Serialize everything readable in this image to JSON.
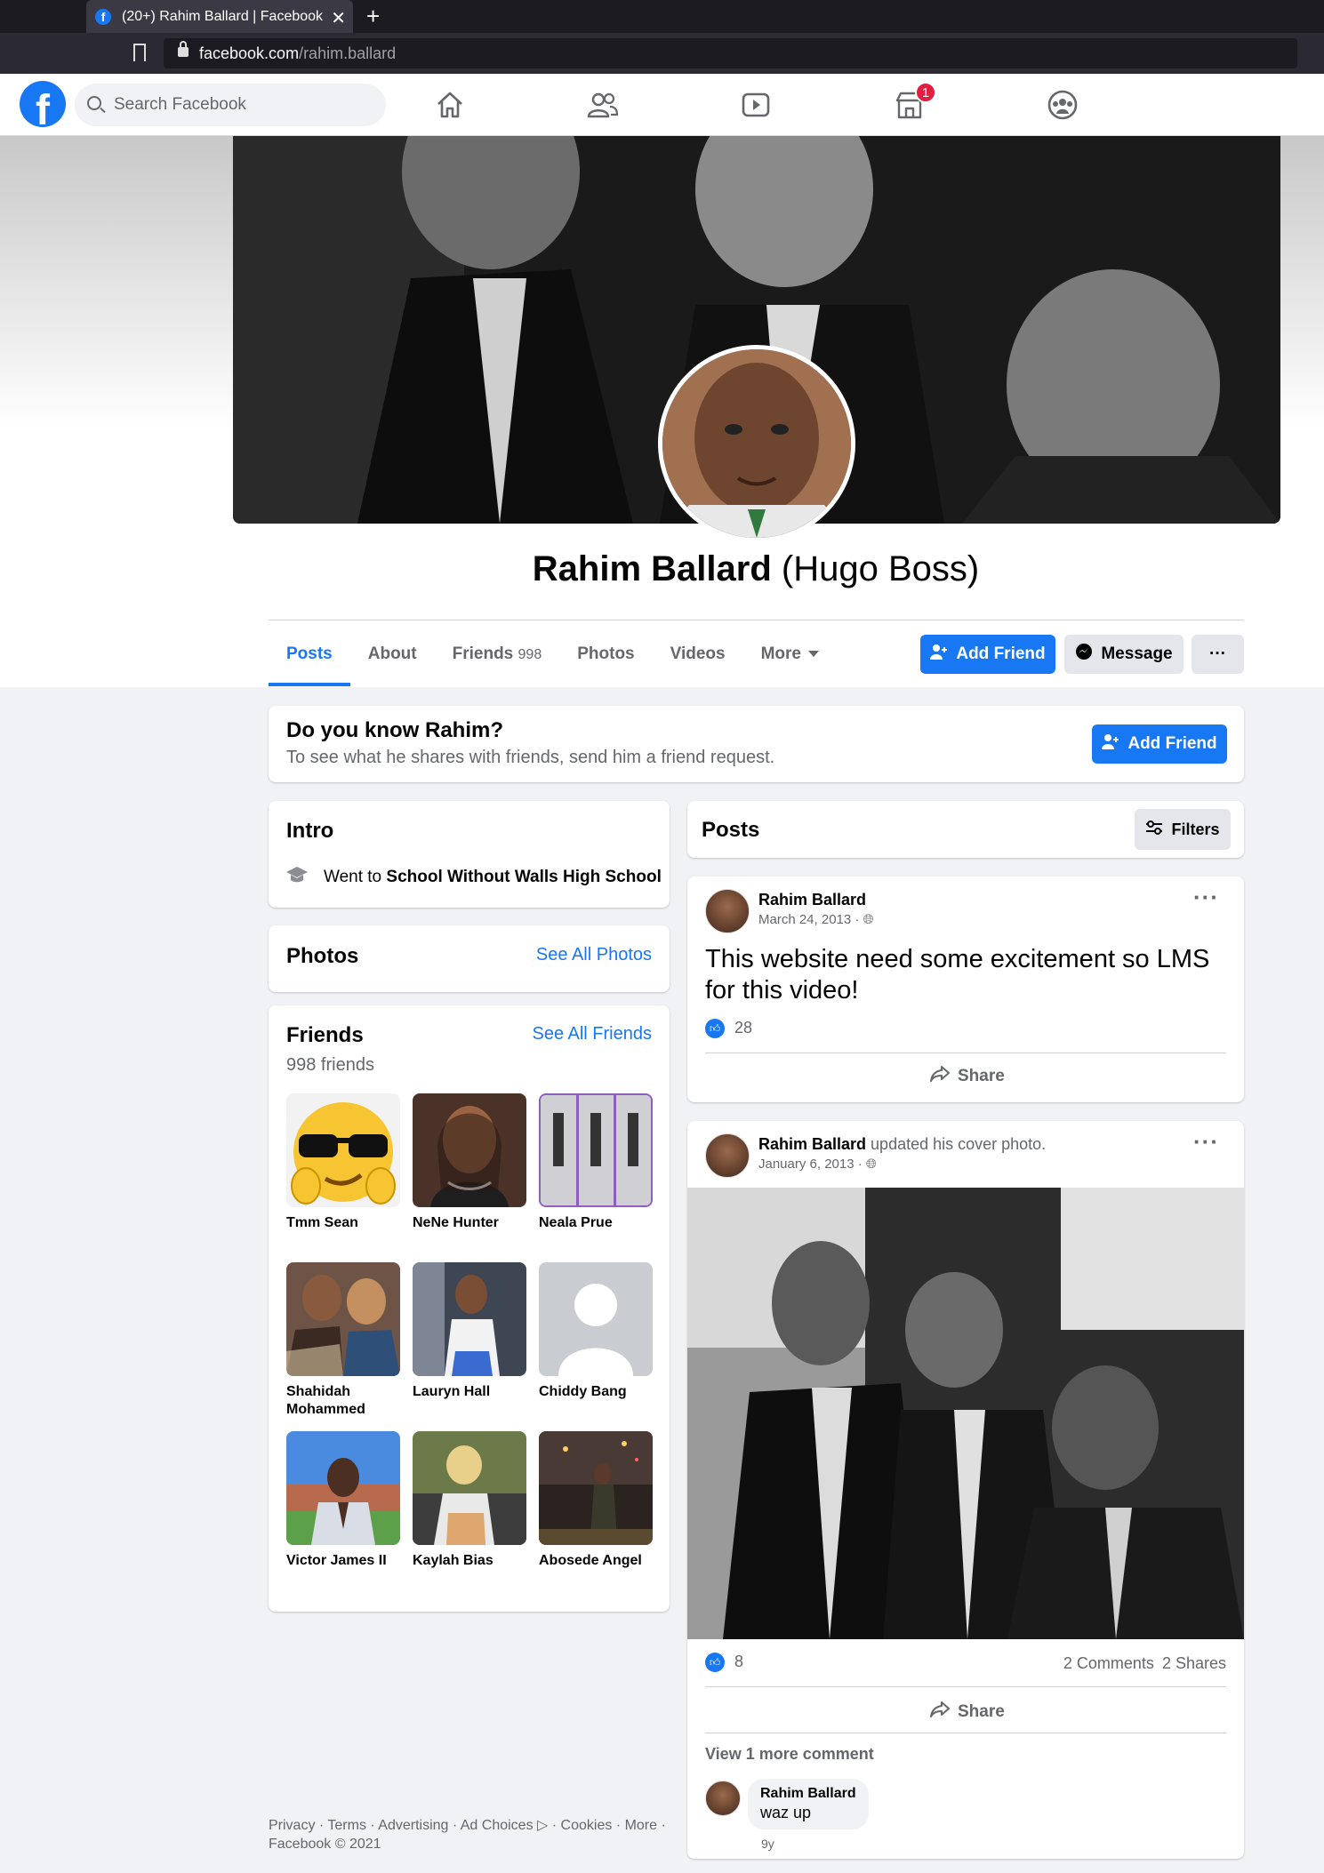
{
  "browser": {
    "tab_title": "(20+) Rahim Ballard | Facebook",
    "url_host": "facebook.com",
    "url_path": "/rahim.ballard"
  },
  "header": {
    "search_placeholder": "Search Facebook",
    "notification_count": "1",
    "nav_icons": [
      "home-icon",
      "friends-icon",
      "watch-icon",
      "marketplace-icon",
      "groups-icon"
    ]
  },
  "profile": {
    "name": "Rahim Ballard",
    "alt_name": "(Hugo Boss)",
    "tabs": [
      {
        "label": "Posts"
      },
      {
        "label": "About"
      },
      {
        "label": "Friends",
        "count": "998"
      },
      {
        "label": "Photos"
      },
      {
        "label": "Videos"
      },
      {
        "label": "More"
      }
    ],
    "add_friend_label": "Add Friend",
    "message_label": "Message",
    "more_label": "···"
  },
  "know": {
    "title": "Do you know Rahim?",
    "subtitle": "To see what he shares with friends, send him a friend request.",
    "button": "Add Friend"
  },
  "intro": {
    "title": "Intro",
    "went_to_prefix": "Went to ",
    "school": "School Without Walls High School"
  },
  "photos": {
    "title": "Photos",
    "see_all": "See All Photos"
  },
  "friends": {
    "title": "Friends",
    "see_all": "See All Friends",
    "count_text": "998 friends",
    "list": [
      {
        "name": "Tmm Sean"
      },
      {
        "name": "NeNe Hunter"
      },
      {
        "name": "Neala Prue"
      },
      {
        "name": "Shahidah Mohammed"
      },
      {
        "name": "Lauryn Hall"
      },
      {
        "name": "Chiddy Bang"
      },
      {
        "name": "Victor James II"
      },
      {
        "name": "Kaylah Bias"
      },
      {
        "name": "Abosede Angel"
      }
    ]
  },
  "posts_header": {
    "title": "Posts",
    "filters": "Filters"
  },
  "post1": {
    "author": "Rahim Ballard",
    "date": "March 24, 2013 · ",
    "text": "This website need some excitement so LMS for this video!",
    "likes": "28",
    "share": "Share"
  },
  "post2": {
    "author": "Rahim Ballard",
    "action": " updated his cover photo.",
    "date": "January 6, 2013 · ",
    "likes": "8",
    "comments": "2 Comments",
    "shares": "2 Shares",
    "share": "Share",
    "view_more": "View 1 more comment",
    "comment_author": "Rahim Ballard",
    "comment_text": "waz up",
    "comment_age": "9y"
  },
  "footer": {
    "line1": "Privacy · Terms · Advertising · Ad Choices ▷ · Cookies · More ·",
    "line2": "Facebook © 2021"
  }
}
